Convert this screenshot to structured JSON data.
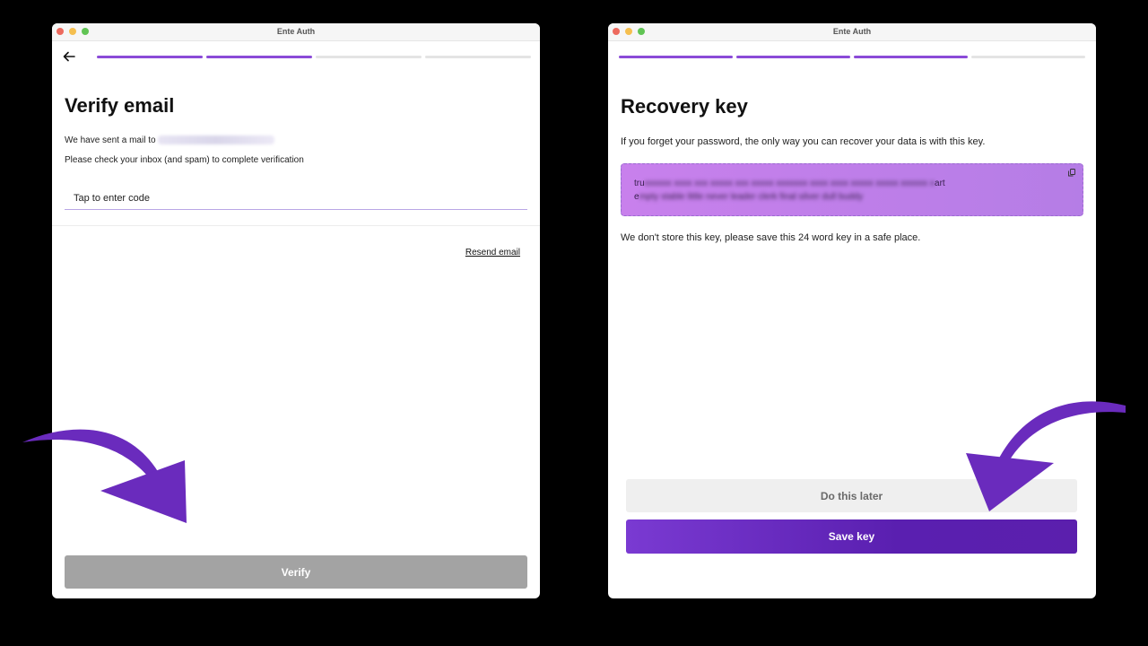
{
  "left_window": {
    "title": "Ente Auth",
    "progress": [
      true,
      true,
      false,
      false
    ],
    "heading": "Verify email",
    "sent_text": "We have sent a mail to",
    "instruction": "Please check your inbox (and spam) to complete verification",
    "code_placeholder": "Tap to enter code",
    "resend_label": "Resend email",
    "verify_label": "Verify"
  },
  "right_window": {
    "title": "Ente Auth",
    "progress": [
      true,
      true,
      true,
      false
    ],
    "heading": "Recovery key",
    "description": "If you forget your password, the only way you can recover your data is with this key.",
    "key_line1_start": "tru",
    "key_line1_end": "art",
    "key_line2_start": "e",
    "note": "We don't store this key, please save this 24 word key in a safe place.",
    "later_label": "Do this later",
    "save_label": "Save key"
  },
  "colors": {
    "accent": "#8b4bd8",
    "arrow": "#6a2bbd",
    "key_box": "#c880ec",
    "verify_disabled": "#a3a3a3"
  },
  "icons": [
    "back-arrow-icon",
    "copy-icon",
    "curved-arrow-icon"
  ]
}
